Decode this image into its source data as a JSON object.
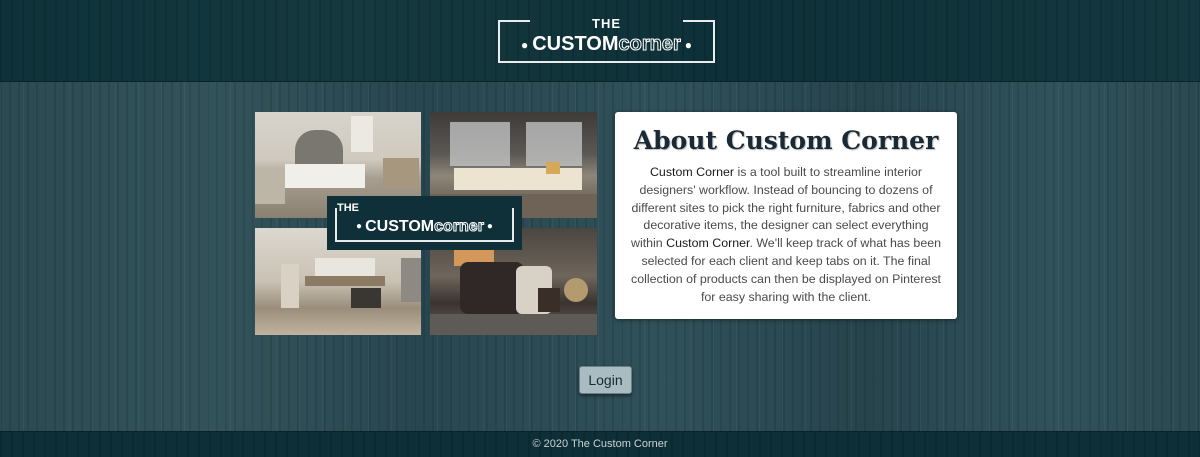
{
  "header": {
    "logo": {
      "top": "THE",
      "word_bold": "CUSTOM",
      "word_outline": "corner"
    }
  },
  "collage": {
    "logo": {
      "top": "THE",
      "word_bold": "CUSTOM",
      "word_outline": "corner"
    }
  },
  "about": {
    "title": "About Custom Corner",
    "brand": "Custom Corner",
    "text_part1": " is a tool built to streamline interior designers' workflow. Instead of bouncing to dozens of different sites to pick the right furniture, fabrics and other decorative items, the designer can select everything within ",
    "text_part2": ". We'll keep track of what has been selected for each client and keep tabs on it. The final collection of products can then be displayed on Pinterest for easy sharing with the client."
  },
  "login": {
    "label": "Login"
  },
  "footer": {
    "copyright": "© 2020 The Custom Corner"
  },
  "colors": {
    "header_bg": "#10343d",
    "body_wood": "#2a4850",
    "button_bg": "#a9bcc1",
    "card_bg": "#ffffff"
  }
}
